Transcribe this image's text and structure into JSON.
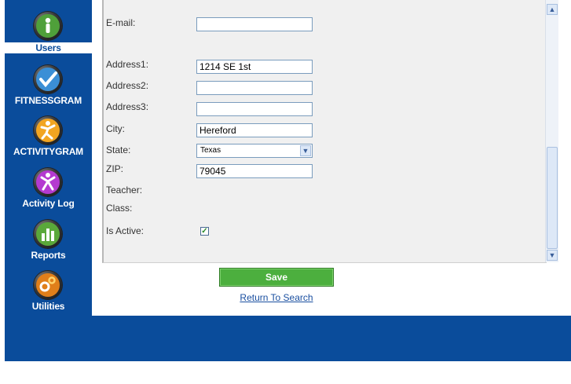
{
  "nav": {
    "items": [
      {
        "label": "Users",
        "icon": "user-icon",
        "active": true
      },
      {
        "label": "FITNESSGRAM",
        "icon": "checkmark-icon"
      },
      {
        "label": "ACTIVITYGRAM",
        "icon": "running-figure-icon"
      },
      {
        "label": "Activity Log",
        "icon": "activity-figure-icon"
      },
      {
        "label": "Reports",
        "icon": "bar-chart-icon"
      },
      {
        "label": "Utilities",
        "icon": "gears-icon"
      }
    ]
  },
  "form": {
    "email": {
      "label": "E-mail:",
      "value": ""
    },
    "address1": {
      "label": "Address1:",
      "value": "1214 SE 1st"
    },
    "address2": {
      "label": "Address2:",
      "value": ""
    },
    "address3": {
      "label": "Address3:",
      "value": ""
    },
    "city": {
      "label": "City:",
      "value": "Hereford"
    },
    "state": {
      "label": "State:",
      "value": "Texas"
    },
    "zip": {
      "label": "ZIP:",
      "value": "79045"
    },
    "teacher": {
      "label": "Teacher:"
    },
    "class": {
      "label": "Class:"
    },
    "is_active": {
      "label": "Is Active:",
      "checked": true
    }
  },
  "actions": {
    "save_label": "Save",
    "return_label": "Return To Search"
  },
  "colors": {
    "brand_blue": "#0a4c9b",
    "save_green": "#4caf3e"
  }
}
